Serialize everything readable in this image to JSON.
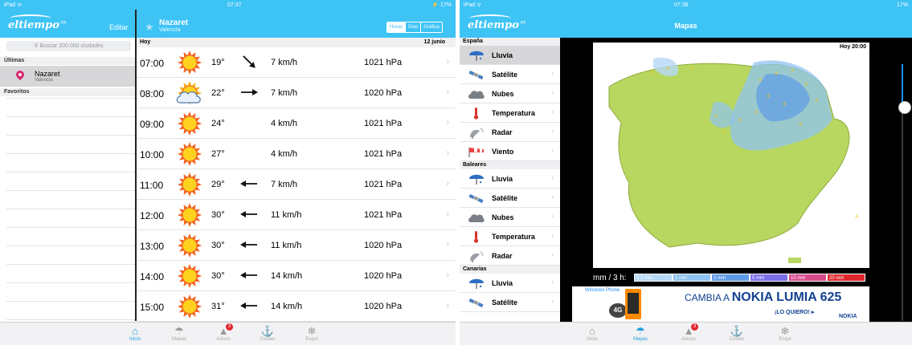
{
  "left": {
    "status": {
      "device": "iPad ᯤ",
      "time": "07:37",
      "battery": "⚡ 17%"
    },
    "app": {
      "logo": "eltiempo",
      "logo_tld": ".es",
      "edit_label": "Editar"
    },
    "location": {
      "name": "Nazaret",
      "region": "Valencia"
    },
    "view_modes": [
      "Horas",
      "Días",
      "Gráfica"
    ],
    "search": {
      "placeholder": "Buscar 200.000 ciudades",
      "icon": "search-icon"
    },
    "sections": {
      "recent": "Últimas",
      "favorites": "Favoritos"
    },
    "recent": {
      "name": "Nazaret",
      "region": "Valencia"
    },
    "forecast": {
      "day_label": "Hoy",
      "date_label": "12 junio",
      "rows": [
        {
          "time": "07:00",
          "icon": "sun",
          "temp": "19°",
          "wind_dir": "se",
          "wind": "7 km/h",
          "pressure": "1021 hPa"
        },
        {
          "time": "08:00",
          "icon": "sun-cloud",
          "temp": "22°",
          "wind_dir": "e",
          "wind": "7 km/h",
          "pressure": "1020 hPa"
        },
        {
          "time": "09:00",
          "icon": "sun",
          "temp": "24°",
          "wind_dir": "",
          "wind": "4 km/h",
          "pressure": "1021 hPa"
        },
        {
          "time": "10:00",
          "icon": "sun",
          "temp": "27°",
          "wind_dir": "",
          "wind": "4 km/h",
          "pressure": "1021 hPa"
        },
        {
          "time": "11:00",
          "icon": "sun",
          "temp": "29°",
          "wind_dir": "w",
          "wind": "7 km/h",
          "pressure": "1021 hPa"
        },
        {
          "time": "12:00",
          "icon": "sun",
          "temp": "30°",
          "wind_dir": "w",
          "wind": "11 km/h",
          "pressure": "1021 hPa"
        },
        {
          "time": "13:00",
          "icon": "sun",
          "temp": "30°",
          "wind_dir": "w",
          "wind": "11 km/h",
          "pressure": "1020 hPa"
        },
        {
          "time": "14:00",
          "icon": "sun",
          "temp": "30°",
          "wind_dir": "w",
          "wind": "14 km/h",
          "pressure": "1020 hPa"
        },
        {
          "time": "15:00",
          "icon": "sun",
          "temp": "31°",
          "wind_dir": "w",
          "wind": "14 km/h",
          "pressure": "1020 hPa"
        }
      ]
    },
    "tabs": [
      {
        "label": "Inicio",
        "icon": "home-icon",
        "glyph": "⌂",
        "active": true,
        "badge": ""
      },
      {
        "label": "Mapas",
        "icon": "maps-icon",
        "glyph": "☂",
        "active": false,
        "badge": ""
      },
      {
        "label": "Avisos",
        "icon": "warning-icon",
        "glyph": "▲",
        "active": false,
        "badge": "3"
      },
      {
        "label": "Costas",
        "icon": "anchor-icon",
        "glyph": "⚓",
        "active": false,
        "badge": ""
      },
      {
        "label": "Esquí",
        "icon": "snowflake-icon",
        "glyph": "❄",
        "active": false,
        "badge": ""
      }
    ]
  },
  "right": {
    "status": {
      "device": "iPad ᯤ",
      "time": "07:36",
      "battery": "17%"
    },
    "app": {
      "logo": "eltiempo",
      "logo_tld": ".es",
      "title": "Mapas"
    },
    "menu": [
      {
        "section": "España",
        "items": [
          {
            "label": "Lluvia",
            "icon": "umbrella-icon",
            "selected": true
          },
          {
            "label": "Satélite",
            "icon": "satellite-icon",
            "selected": false
          },
          {
            "label": "Nubes",
            "icon": "cloud-icon",
            "selected": false
          },
          {
            "label": "Temperatura",
            "icon": "thermometer-icon",
            "selected": false
          },
          {
            "label": "Radar",
            "icon": "radar-icon",
            "selected": false
          },
          {
            "label": "Viento",
            "icon": "windsock-icon",
            "selected": false
          }
        ]
      },
      {
        "section": "Baleares",
        "items": [
          {
            "label": "Lluvia",
            "icon": "umbrella-icon",
            "selected": false
          },
          {
            "label": "Satélite",
            "icon": "satellite-icon",
            "selected": false
          },
          {
            "label": "Nubes",
            "icon": "cloud-icon",
            "selected": false
          },
          {
            "label": "Temperatura",
            "icon": "thermometer-icon",
            "selected": false
          },
          {
            "label": "Radar",
            "icon": "radar-icon",
            "selected": false
          }
        ]
      },
      {
        "section": "Canarias",
        "items": [
          {
            "label": "Lluvia",
            "icon": "umbrella-icon",
            "selected": false
          },
          {
            "label": "Satélite",
            "icon": "satellite-icon",
            "selected": false
          }
        ]
      }
    ],
    "map": {
      "time_label": "Hoy 20:00",
      "legend_unit": "mm / 3 h:",
      "legend": [
        {
          "label": "0.2 mm",
          "color": "#b5d8f7"
        },
        {
          "label": "1 mm",
          "color": "#8fc3f1"
        },
        {
          "label": "2 mm",
          "color": "#5e9be6"
        },
        {
          "label": "5 mm",
          "color": "#7b6ee8"
        },
        {
          "label": "10 mm",
          "color": "#d84a8c"
        },
        {
          "label": "20 mm",
          "color": "#e0262d"
        }
      ],
      "slider_value": 0.17
    },
    "ad": {
      "brand_line": "Windows Phone",
      "headline": "CAMBIA A",
      "product": "NOKIA LUMIA 625",
      "cta": "¡LO QUIERO! ▸",
      "badge": "4G",
      "brand": "NOKIA"
    },
    "tabs": [
      {
        "label": "Inicio",
        "icon": "home-icon",
        "glyph": "⌂",
        "active": false,
        "badge": ""
      },
      {
        "label": "Mapas",
        "icon": "maps-icon",
        "glyph": "☂",
        "active": true,
        "badge": ""
      },
      {
        "label": "Avisos",
        "icon": "warning-icon",
        "glyph": "▲",
        "active": false,
        "badge": "3"
      },
      {
        "label": "Costas",
        "icon": "anchor-icon",
        "glyph": "⚓",
        "active": false,
        "badge": ""
      },
      {
        "label": "Esquí",
        "icon": "snowflake-icon",
        "glyph": "❄",
        "active": false,
        "badge": ""
      }
    ]
  }
}
